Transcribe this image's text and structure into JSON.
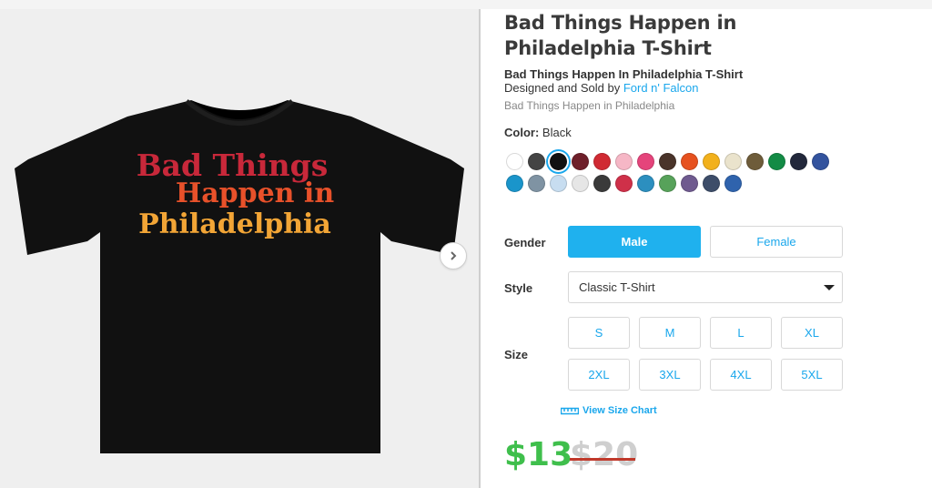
{
  "product": {
    "title": "Bad Things Happen in Philadelphia T-Shirt",
    "subtitle": "Bad Things Happen In Philadelphia T-Shirt",
    "designed_prefix": "Designed and Sold by ",
    "designer": "Ford n' Falcon",
    "tagline": "Bad Things Happen in Philadelphia"
  },
  "artwork": {
    "line1": "Bad Things",
    "line2": "Happen in",
    "line3": "Philadelphia",
    "line1_color": "#c8283a",
    "line2_color": "#e8512a",
    "line3_color": "#f2a536",
    "shirt_color": "#111111"
  },
  "color": {
    "label": "Color:",
    "value": "Black",
    "swatches": [
      "#ffffff",
      "#444444",
      "#111111",
      "#6e1f2a",
      "#d02a33",
      "#f6b7c6",
      "#e5447b",
      "#4a342a",
      "#e6511f",
      "#f2b11c",
      "#eae3cc",
      "#6e5c3a",
      "#138b45",
      "#22283b",
      "#33539e",
      "#1a95cb",
      "#7f93a3",
      "#c7ddf0",
      "#e6e6e6",
      "#3a3a3a",
      "#cf3049",
      "#2c8fbf",
      "#57a25a",
      "#6f5a8f",
      "#3d4d69",
      "#2f63ad"
    ]
  },
  "gender": {
    "label": "Gender",
    "male": "Male",
    "female": "Female"
  },
  "style": {
    "label": "Style",
    "value": "Classic T-Shirt"
  },
  "size": {
    "label": "Size",
    "options": [
      "S",
      "M",
      "L",
      "XL",
      "2XL",
      "3XL",
      "4XL",
      "5XL"
    ],
    "chart_label": "View Size Chart"
  },
  "price": {
    "current": "$13",
    "original": "$20"
  },
  "colors": {
    "accent": "#1aa7ec",
    "price_green": "#3fbf4c",
    "strike_red": "#c0392b"
  }
}
